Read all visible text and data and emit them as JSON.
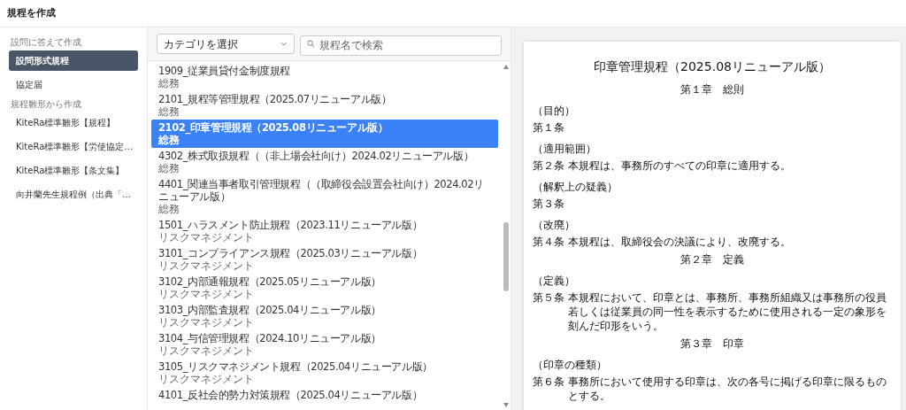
{
  "header": {
    "title": "規程を作成"
  },
  "sidebar": {
    "sections": [
      {
        "label": "設問に答えて作成",
        "items": [
          {
            "label": "設問形式規程",
            "selected": true
          },
          {
            "label": "協定届",
            "selected": false
          }
        ]
      },
      {
        "label": "規程雛形から作成",
        "items": [
          {
            "label": "KiteRa標準雛形【規程】",
            "selected": false
          },
          {
            "label": "KiteRa標準雛形【労使協定…",
            "selected": false
          },
          {
            "label": "KiteRa標準雛形【条文集】",
            "selected": false
          },
          {
            "label": "向井蘭先生規程例（出典「…",
            "selected": false
          }
        ]
      }
    ]
  },
  "filters": {
    "category_select": {
      "value": "カテゴリを選択"
    },
    "search": {
      "placeholder": "規程名で検索"
    }
  },
  "list": {
    "items": [
      {
        "title": "1909_従業員貸付金制度規程",
        "category": "総務",
        "selected": false
      },
      {
        "title": "2101_規程等管理規程（2025.07リニューアル版）",
        "category": "総務",
        "selected": false
      },
      {
        "title": "2102_印章管理規程（2025.08リニューアル版）",
        "category": "総務",
        "selected": true
      },
      {
        "title": "4302_株式取扱規程（（非上場会社向け）2024.02リニューアル版）",
        "category": "総務",
        "selected": false
      },
      {
        "title": "4401_関連当事者取引管理規程（（取締役会設置会社向け）2024.02リニューアル版）",
        "category": "総務",
        "selected": false
      },
      {
        "title": "1501_ハラスメント防止規程（2023.11リニューアル版）",
        "category": "リスクマネジメント",
        "selected": false
      },
      {
        "title": "3101_コンプライアンス規程（2025.03リニューアル版）",
        "category": "リスクマネジメント",
        "selected": false
      },
      {
        "title": "3102_内部通報規程（2025.05リニューアル版）",
        "category": "リスクマネジメント",
        "selected": false
      },
      {
        "title": "3103_内部監査規程（2025.04リニューアル版）",
        "category": "リスクマネジメント",
        "selected": false
      },
      {
        "title": "3104_与信管理規程（2024.10リニューアル版）",
        "category": "リスクマネジメント",
        "selected": false
      },
      {
        "title": "3105_リスクマネジメント規程（2025.04リニューアル版）",
        "category": "リスクマネジメント",
        "selected": false
      },
      {
        "title": "4101_反社会的勢力対策規程（2025.04リニューアル版）",
        "selected": false
      }
    ]
  },
  "document": {
    "title": "印章管理規程（2025.08リニューアル版）",
    "blocks": [
      {
        "kind": "chapter",
        "text": "第１章　総則"
      },
      {
        "kind": "caption",
        "text": "（目的）"
      },
      {
        "kind": "article",
        "number": "第１条"
      },
      {
        "kind": "caption",
        "text": "（適用範囲）"
      },
      {
        "kind": "article",
        "number": "第２条",
        "text": "本規程は、事務所のすべての印章に適用する。"
      },
      {
        "kind": "caption",
        "text": "（解釈上の疑義）"
      },
      {
        "kind": "article",
        "number": "第３条"
      },
      {
        "kind": "caption",
        "text": "（改廃）"
      },
      {
        "kind": "article",
        "number": "第４条",
        "text": "本規程は、取締役会の決議により、改廃する。"
      },
      {
        "kind": "chapter",
        "text": "第２章　定義"
      },
      {
        "kind": "caption",
        "text": "（定義）"
      },
      {
        "kind": "article",
        "number": "第５条",
        "text": "本規程において、印章とは、事務所、事務所組織又は事務所の役員若しくは従業員の同一性を表示するために使用される一定の象形を刻んだ印形をいう。"
      },
      {
        "kind": "chapter",
        "text": "第３章　印章"
      },
      {
        "kind": "caption",
        "text": "（印章の種類）"
      },
      {
        "kind": "article",
        "number": "第６条",
        "text": "事務所において使用する印章は、次の各号に掲げる印章に限るものとする。"
      }
    ]
  }
}
